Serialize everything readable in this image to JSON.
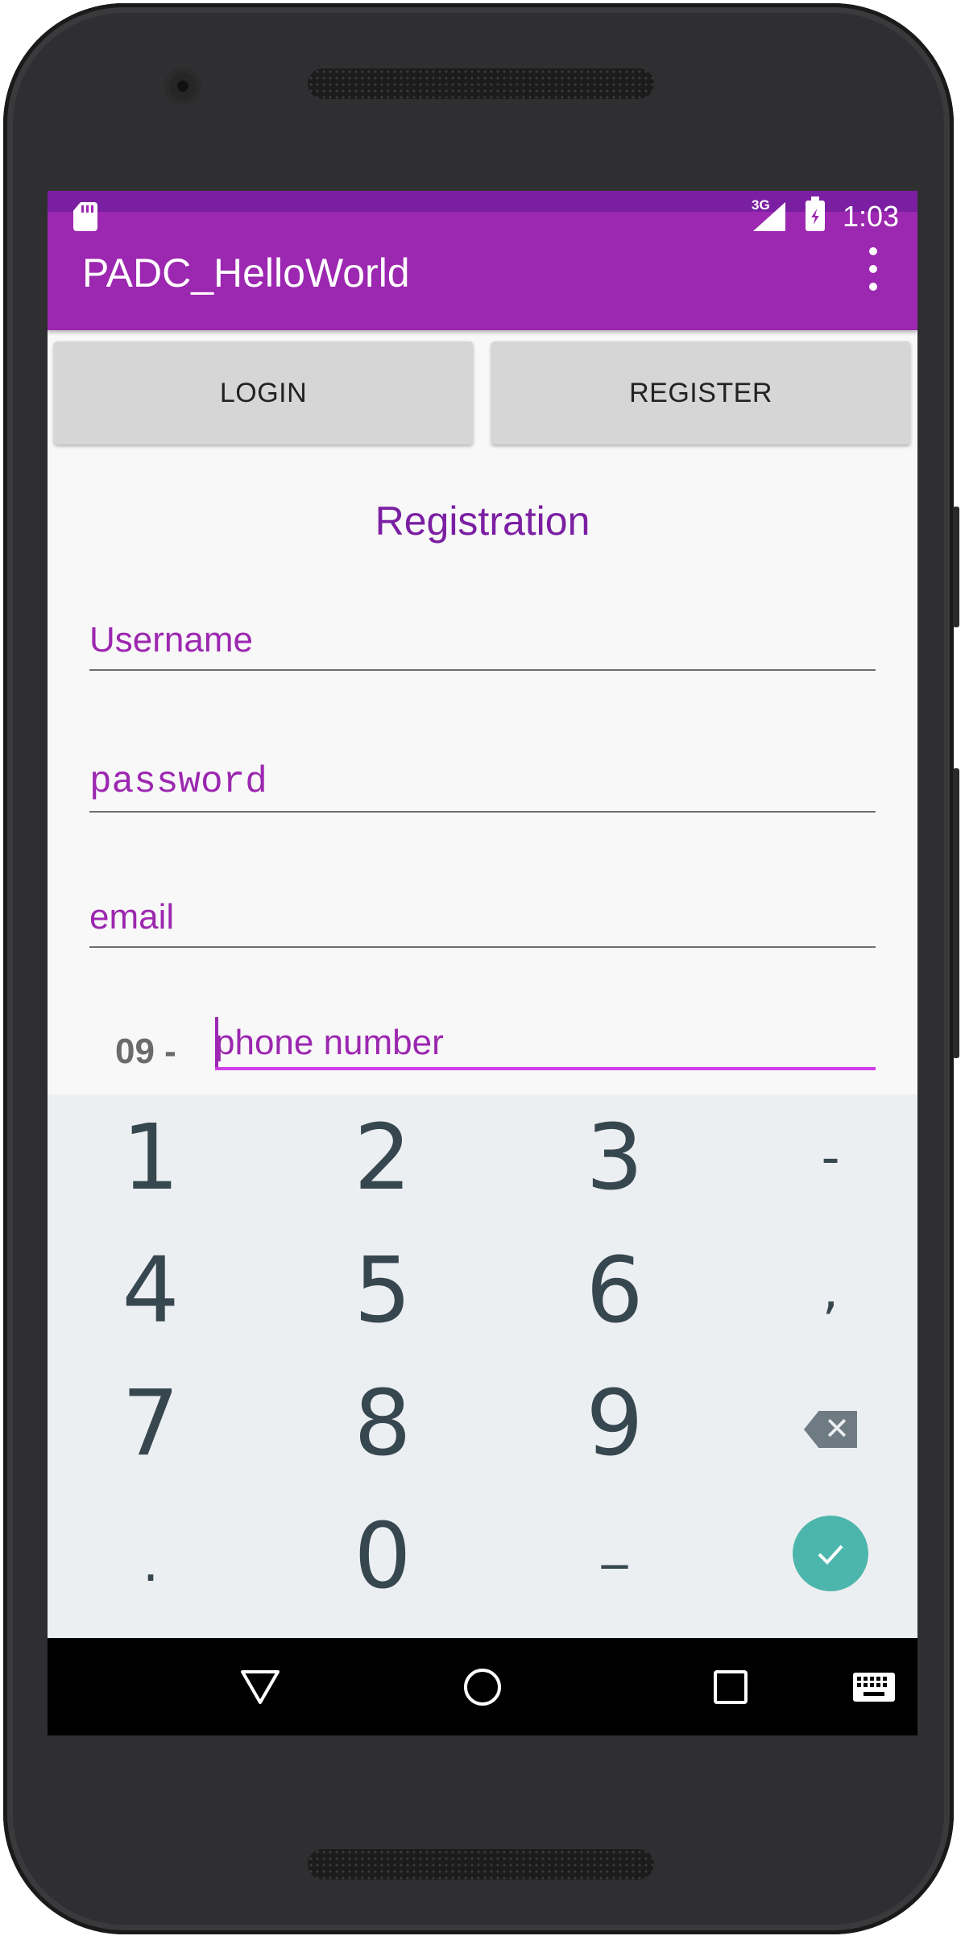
{
  "status_bar": {
    "network_type": "3G",
    "time": "1:03",
    "icons": [
      "sd-card-icon",
      "signal-icon",
      "battery-charging-icon"
    ]
  },
  "app_bar": {
    "title": "PADC_HelloWorld",
    "overflow_icon": "overflow-menu-icon"
  },
  "tabs": {
    "login_label": "LOGIN",
    "register_label": "REGISTER"
  },
  "form": {
    "title": "Registration",
    "username_placeholder": "Username",
    "password_placeholder": "password",
    "email_placeholder": "email",
    "phone_prefix": "09 -",
    "phone_placeholder": "phone number"
  },
  "keypad": {
    "keys": [
      "1",
      "2",
      "3",
      "-",
      "4",
      "5",
      "6",
      ",",
      "7",
      "8",
      "9",
      ".",
      "0",
      "_"
    ],
    "backspace_icon": "backspace-icon",
    "done_icon": "checkmark-icon"
  },
  "nav_bar": {
    "icons": [
      "back-icon",
      "home-icon",
      "recents-icon",
      "keyboard-icon"
    ]
  },
  "colors": {
    "primary": "#9c27b0",
    "primary_dark": "#7b1fa2",
    "accent": "#d03ee8",
    "keypad_bg": "#eceff1",
    "key_text": "#37474f",
    "done_button": "#4db6ac"
  }
}
